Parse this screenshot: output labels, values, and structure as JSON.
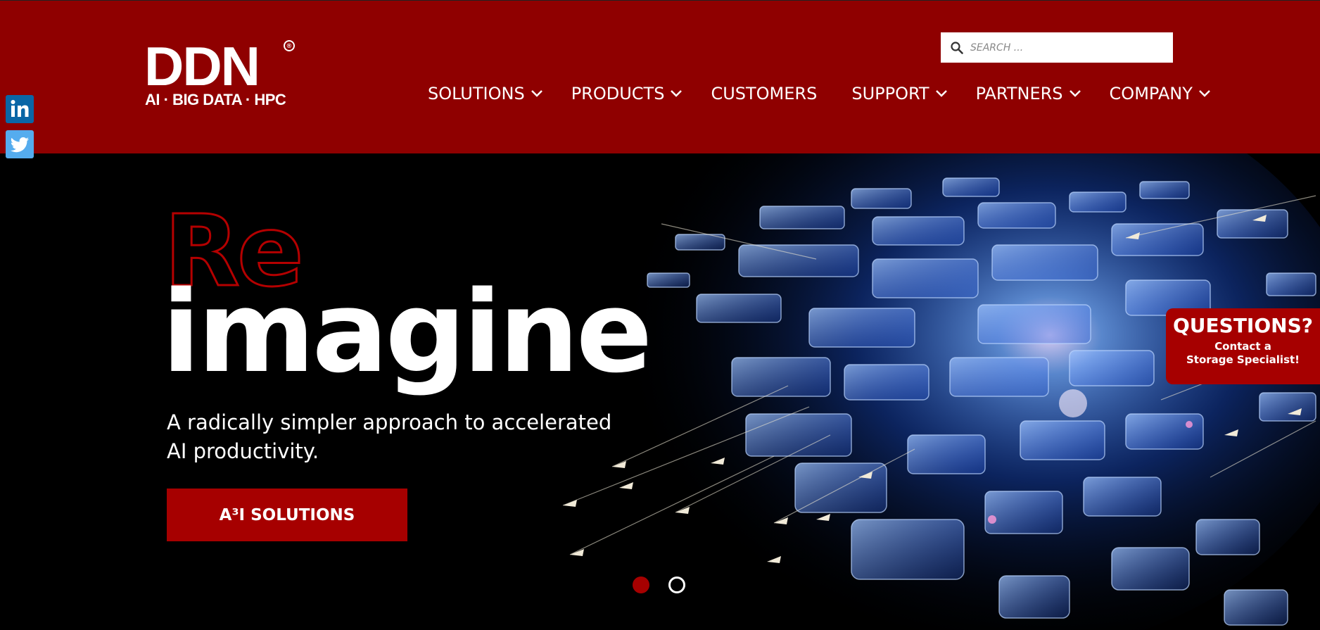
{
  "header": {
    "logo": {
      "main": "DDN",
      "registered": "®",
      "tagline": "AI · BIG DATA · HPC"
    },
    "search": {
      "placeholder": "SEARCH ..."
    },
    "nav": [
      {
        "label": "SOLUTIONS",
        "has_dropdown": true
      },
      {
        "label": "PRODUCTS",
        "has_dropdown": true
      },
      {
        "label": "CUSTOMERS",
        "has_dropdown": false
      },
      {
        "label": "SUPPORT",
        "has_dropdown": true
      },
      {
        "label": "PARTNERS",
        "has_dropdown": true
      },
      {
        "label": "COMPANY",
        "has_dropdown": true
      }
    ]
  },
  "social": [
    {
      "icon": "linkedin-icon",
      "color": "#0a66a6"
    },
    {
      "icon": "twitter-icon",
      "color": "#55acee"
    }
  ],
  "hero": {
    "headline_outline": "Re",
    "headline_main": "imagine",
    "subtitle": "A radically simpler approach to accelerated AI productivity.",
    "cta_label": "A³I SOLUTIONS",
    "slides_total": 2,
    "active_slide": 1
  },
  "questions_tab": {
    "title": "QUESTIONS?",
    "line1": "Contact a",
    "line2": "Storage Specialist!"
  },
  "colors": {
    "header_bg": "#8f0000",
    "accent": "#a60000",
    "hero_bg": "#000000"
  }
}
